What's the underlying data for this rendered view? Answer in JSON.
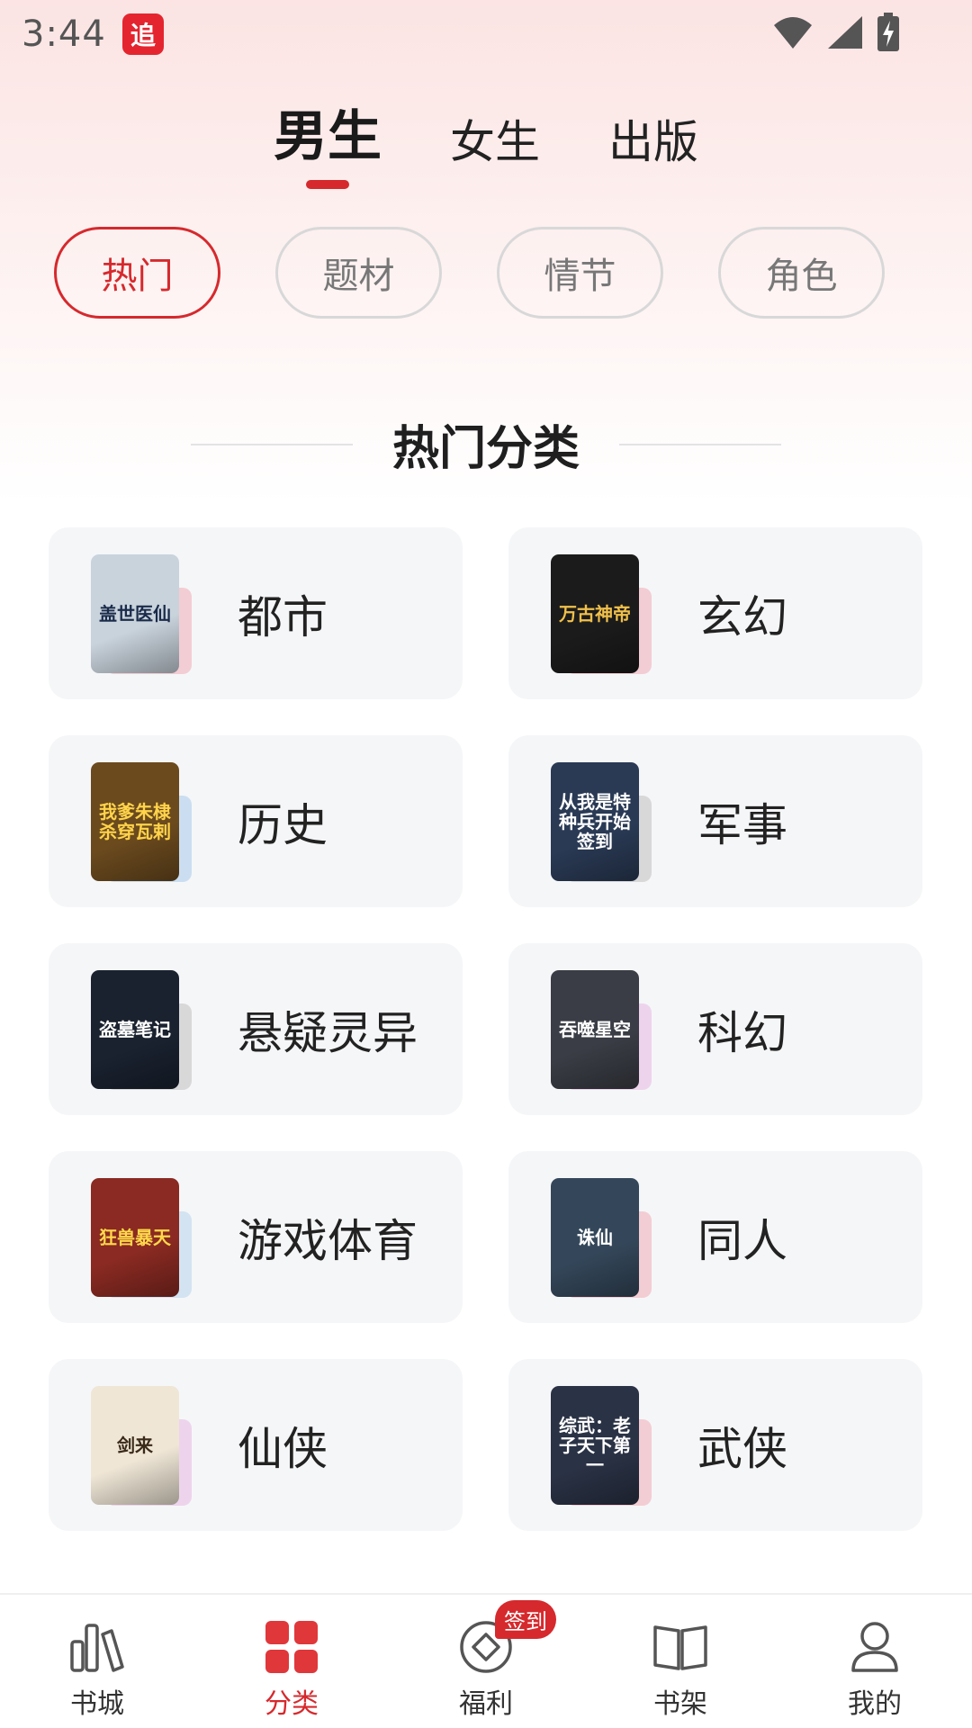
{
  "status_bar": {
    "time": "3:44",
    "app_icon_text": "追"
  },
  "top_tabs": [
    {
      "label": "男生",
      "active": true
    },
    {
      "label": "女生",
      "active": false
    },
    {
      "label": "出版",
      "active": false
    }
  ],
  "chips": [
    {
      "label": "热门",
      "active": true
    },
    {
      "label": "题材",
      "active": false
    },
    {
      "label": "情节",
      "active": false
    },
    {
      "label": "角色",
      "active": false
    }
  ],
  "section_title": "热门分类",
  "categories": [
    {
      "label": "都市",
      "cover_title": "盖世医仙",
      "cover_color": "#c9d3dc",
      "cover_text_color": "#1a2b4a",
      "shadow_color": "#f3c9cf"
    },
    {
      "label": "玄幻",
      "cover_title": "万古神帝",
      "cover_color": "#1b1b1b",
      "cover_text_color": "#f0c04a",
      "shadow_color": "#f3c9cf"
    },
    {
      "label": "历史",
      "cover_title": "我爹朱棣杀穿瓦剌",
      "cover_color": "#6b4a1e",
      "cover_text_color": "#ffd34a",
      "shadow_color": "#c6dcef"
    },
    {
      "label": "军事",
      "cover_title": "从我是特种兵开始签到",
      "cover_color": "#2a3a55",
      "cover_text_color": "#ffffff",
      "shadow_color": "#d5d5d5"
    },
    {
      "label": "悬疑灵异",
      "cover_title": "盗墓笔记",
      "cover_color": "#1a2230",
      "cover_text_color": "#ffffff",
      "shadow_color": "#d5d5d5"
    },
    {
      "label": "科幻",
      "cover_title": "吞噬星空",
      "cover_color": "#3a3d45",
      "cover_text_color": "#ffffff",
      "shadow_color": "#ecd0ea"
    },
    {
      "label": "游戏体育",
      "cover_title": "狂兽暴天",
      "cover_color": "#8a2a22",
      "cover_text_color": "#ffd84a",
      "shadow_color": "#cfe1f0"
    },
    {
      "label": "同人",
      "cover_title": "诛仙",
      "cover_color": "#34475a",
      "cover_text_color": "#ffffff",
      "shadow_color": "#f3c9cf"
    },
    {
      "label": "仙侠",
      "cover_title": "剑来",
      "cover_color": "#efe6d6",
      "cover_text_color": "#3a2a1a",
      "shadow_color": "#ecd0ea"
    },
    {
      "label": "武侠",
      "cover_title": "综武：老子天下第一",
      "cover_color": "#2a3245",
      "cover_text_color": "#ffffff",
      "shadow_color": "#f3c9cf"
    }
  ],
  "bottom_nav": [
    {
      "label": "书城",
      "icon": "bookstore-icon",
      "active": false
    },
    {
      "label": "分类",
      "icon": "category-grid-icon",
      "active": true
    },
    {
      "label": "福利",
      "icon": "welfare-coin-icon",
      "active": false,
      "badge": "签到"
    },
    {
      "label": "书架",
      "icon": "bookshelf-icon",
      "active": false
    },
    {
      "label": "我的",
      "icon": "profile-icon",
      "active": false
    }
  ],
  "colors": {
    "accent": "#d6292d",
    "card_bg": "#f5f6f8"
  }
}
